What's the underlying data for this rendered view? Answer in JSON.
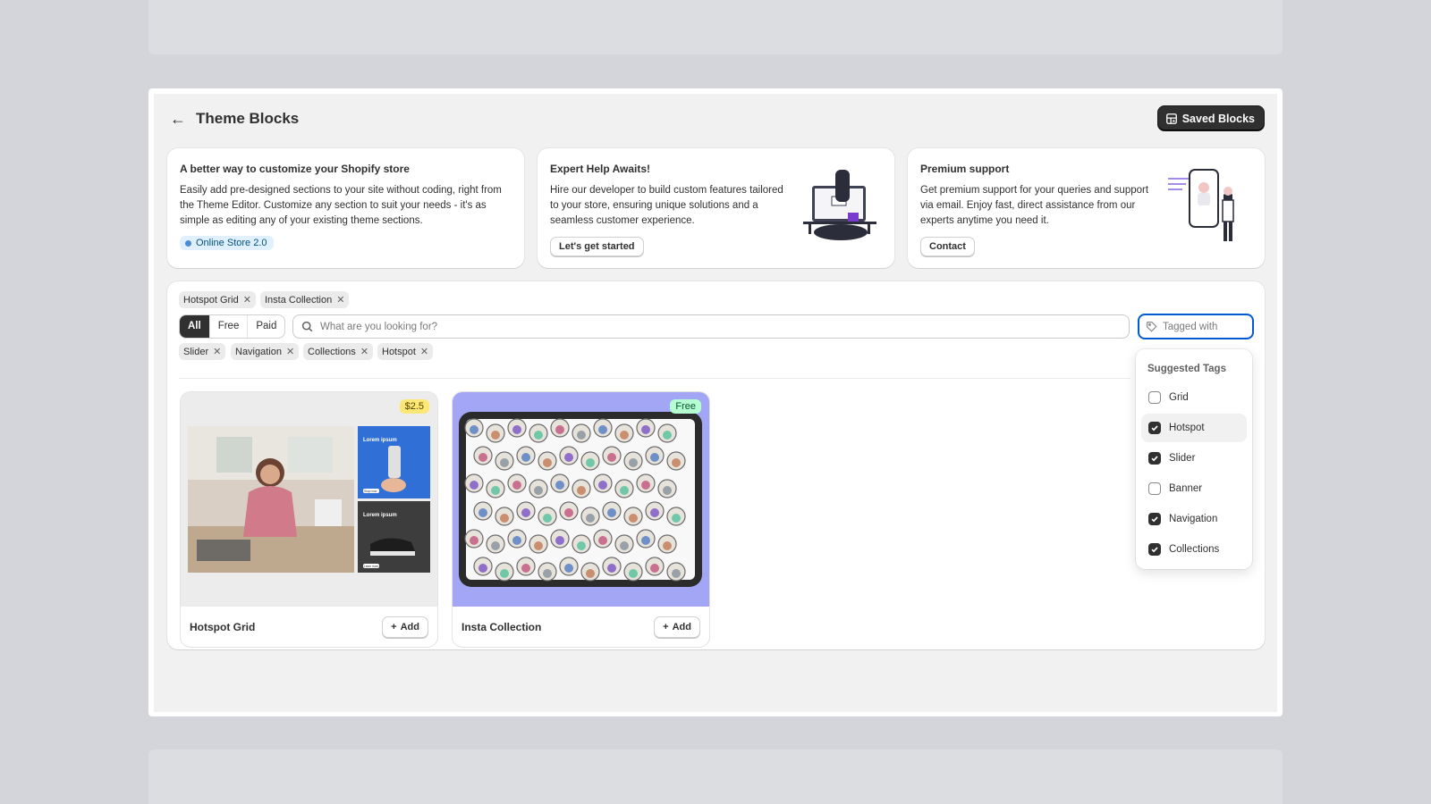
{
  "header": {
    "title": "Theme Blocks",
    "saved_button": "Saved Blocks"
  },
  "info_cards": [
    {
      "title": "A better way to customize your Shopify store",
      "body": "Easily add pre-designed sections to your site without coding, right from the Theme Editor. Customize any section to suit your needs - it's as simple as editing any of your existing theme sections.",
      "badge": "Online Store 2.0"
    },
    {
      "title": "Expert Help Awaits!",
      "body": "Hire our developer to build custom features tailored to your store, ensuring unique solutions and a seamless customer experience.",
      "button": "Let's get started"
    },
    {
      "title": "Premium support",
      "body": "Get premium support for your queries and support via email. Enjoy fast, direct assistance from our experts anytime you need it.",
      "button": "Contact"
    }
  ],
  "filters": {
    "block_chips": [
      "Hotspot Grid",
      "Insta Collection"
    ],
    "segments": [
      "All",
      "Free",
      "Paid"
    ],
    "active_segment": "All",
    "search_placeholder": "What are you looking for?",
    "tag_placeholder": "Tagged with",
    "tag_chips": [
      "Slider",
      "Navigation",
      "Collections",
      "Hotspot"
    ]
  },
  "blocks": [
    {
      "name": "Hotspot Grid",
      "price": "$2.5",
      "add_label": "Add"
    },
    {
      "name": "Insta Collection",
      "price": "Free",
      "add_label": "Add"
    }
  ],
  "suggested_tags": {
    "title": "Suggested Tags",
    "items": [
      {
        "label": "Grid",
        "checked": false
      },
      {
        "label": "Hotspot",
        "checked": true
      },
      {
        "label": "Slider",
        "checked": true
      },
      {
        "label": "Banner",
        "checked": false
      },
      {
        "label": "Navigation",
        "checked": true
      },
      {
        "label": "Collections",
        "checked": true
      }
    ]
  },
  "preview_texts": {
    "card_a": "Lorem ipsum",
    "card_b": "Lorem ipsum",
    "btn_a": "Shop now",
    "btn_b": "Learn more"
  },
  "colors": {
    "primary_button": "#303030",
    "focus_border": "#005bd3",
    "paid_badge": "#ffe775",
    "free_badge": "#b4fed2",
    "insta_bg": "#a3a6f4"
  }
}
